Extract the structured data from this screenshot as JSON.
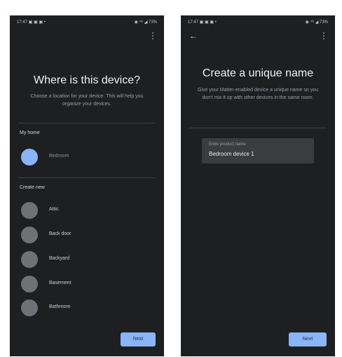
{
  "left_screen": {
    "status_left": "17:47 ▣ ▣ ▣ •",
    "status_right": "◉ ⁴ᴳ ◢ 73%",
    "menu_icon": "more-vert-icon",
    "title": "Where is this device?",
    "subtitle": "Choose a location for your device. This will help you organize your devices.",
    "my_home_label": "My home",
    "existing_rooms": [
      {
        "label": "Bedroom",
        "selected": true
      }
    ],
    "create_new_label": "Create new",
    "new_rooms": [
      {
        "label": "Attic"
      },
      {
        "label": "Back door"
      },
      {
        "label": "Backyard"
      },
      {
        "label": "Basement"
      },
      {
        "label": "Bathroom"
      }
    ],
    "next_label": "Next"
  },
  "right_screen": {
    "status_left": "17:47 ▣ ▣ ▣ •",
    "status_right": "◉ ⁴ᴳ ◢ 73%",
    "back_icon": "back-arrow-icon",
    "menu_icon": "more-vert-icon",
    "title": "Create a unique name",
    "subtitle": "Give your Matter-enabled device a unique name so you don't mix it up with other devices in the same room.",
    "field_label": "Enter product name",
    "field_value": "Bedroom device 1",
    "next_label": "Next"
  },
  "colors": {
    "background": "#1e1f21",
    "accent": "#8ab4f8",
    "radio_unselected": "#6f7174",
    "field_bg": "#3b3c3f"
  }
}
